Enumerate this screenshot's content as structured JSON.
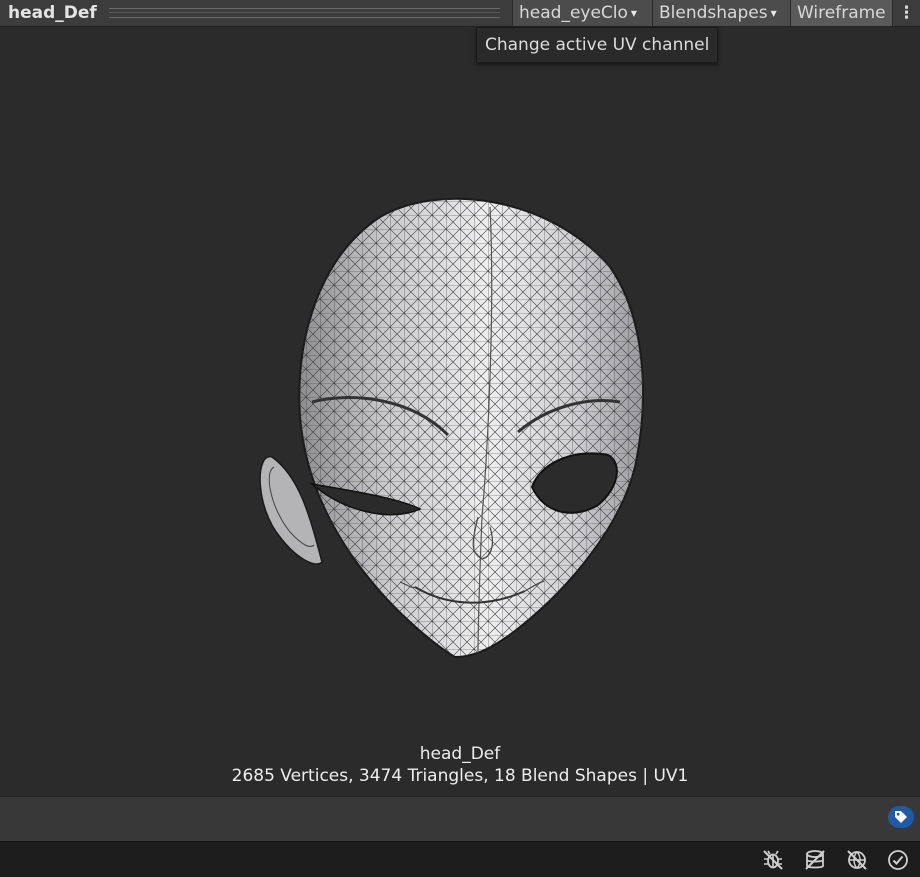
{
  "header": {
    "title": "head_Def",
    "uv_dropdown": "head_eyeClo",
    "blendshapes_dropdown": "Blendshapes",
    "wireframe_button": "Wireframe",
    "menu_glyph": "⋮"
  },
  "tooltip": {
    "text": "Change active UV channel"
  },
  "preview": {
    "mesh_name": "head_Def",
    "stats": "2685 Vertices, 3474 Triangles, 18 Blend Shapes | UV1"
  },
  "icons": {
    "dropdown_caret": "▾",
    "label": "tag-icon",
    "status": [
      "bug-off-icon",
      "cache-server-icon",
      "network-off-icon",
      "checkmark-circle-icon"
    ]
  },
  "colors": {
    "background": "#2b2b2b",
    "header": "#3c3c3c",
    "tag_accent": "#1f5aa8"
  }
}
